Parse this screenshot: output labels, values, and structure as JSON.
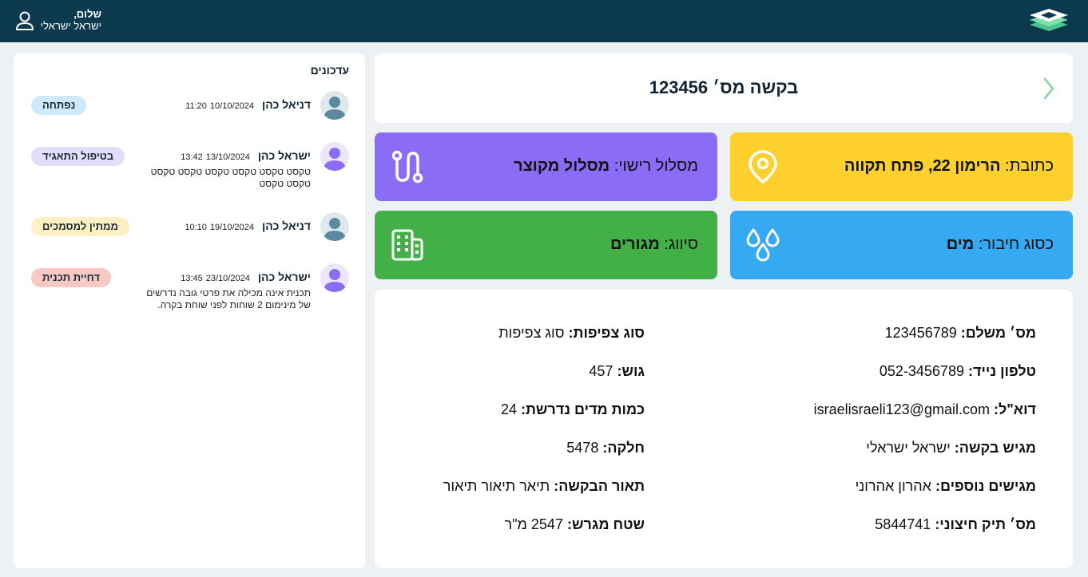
{
  "header": {
    "greeting": "שלום,",
    "user_name": "ישראל ישראלי",
    "bar_color": "#0b3a4e"
  },
  "updates": {
    "title": "עדכונים",
    "items": [
      {
        "name": "דניאל כהן",
        "date": "10/10/2024",
        "time": "11:20",
        "text": "",
        "badge": "נפתחה",
        "badge_color": "#cfe8fa",
        "avatar_color": "#5a8aa0"
      },
      {
        "name": "ישראל כהן",
        "date": "13/10/2024",
        "time": "13:42",
        "text": "טקסט טקסט טקסט טקסט טקסט טקסט טקסט טקסט",
        "badge": "בטיפול התאגיד",
        "badge_color": "#e4dcfb",
        "avatar_color": "#8b6cf6"
      },
      {
        "name": "דניאל כהן",
        "date": "19/10/2024",
        "time": "10:10",
        "text": "",
        "badge": "ממתין למסמכים",
        "badge_color": "#fdf0c4",
        "avatar_color": "#5a8aa0"
      },
      {
        "name": "ישראל כהן",
        "date": "23/10/2024",
        "time": "13:45",
        "text": "תכנית אינה מכילה את פרטי גובה נדרשים של מינימום 2 שוחות לפני שוחת בקרה.",
        "badge": "דחיית תכנית",
        "badge_color": "#f8c8c4",
        "avatar_color": "#8b6cf6"
      }
    ]
  },
  "request": {
    "title": "בקשה מס׳ 123456",
    "address_label": "כתובת:",
    "address_value": "הרימון 22, פתח תקווה",
    "route_label": "מסלול רישוי:",
    "route_value": "מסלול מקוצר",
    "conn_label": "כסוג חיבור:",
    "conn_value": "מים",
    "class_label": "סיווג:",
    "class_value": "מגורים"
  },
  "details": {
    "right": [
      {
        "label": "מס׳ משלם:",
        "value": "123456789"
      },
      {
        "label": "טלפון  נייד:",
        "value": "052-3456789"
      },
      {
        "label": "דוא\"ל:",
        "value": "israelisraeli123@gmail.com"
      },
      {
        "label": "מגיש בקשה:",
        "value": "ישראל ישראלי"
      },
      {
        "label": "מגישים נוספים:",
        "value": "אהרון אהרוני"
      },
      {
        "label": "מס׳ תיק חיצוני:",
        "value": "5844741"
      }
    ],
    "left": [
      {
        "label": "סוג צפיפות:",
        "value": "סוג צפיפות"
      },
      {
        "label": "גוש:",
        "value": "457"
      },
      {
        "label": "כמות מדים נדרשת:",
        "value": "24"
      },
      {
        "label": "חלקה:",
        "value": "5478"
      },
      {
        "label": "תאור הבקשה:",
        "value": "תיאר תיאור תיאור"
      },
      {
        "label": "שטח מגרש:",
        "value": "2547 מ\"ר"
      }
    ]
  }
}
